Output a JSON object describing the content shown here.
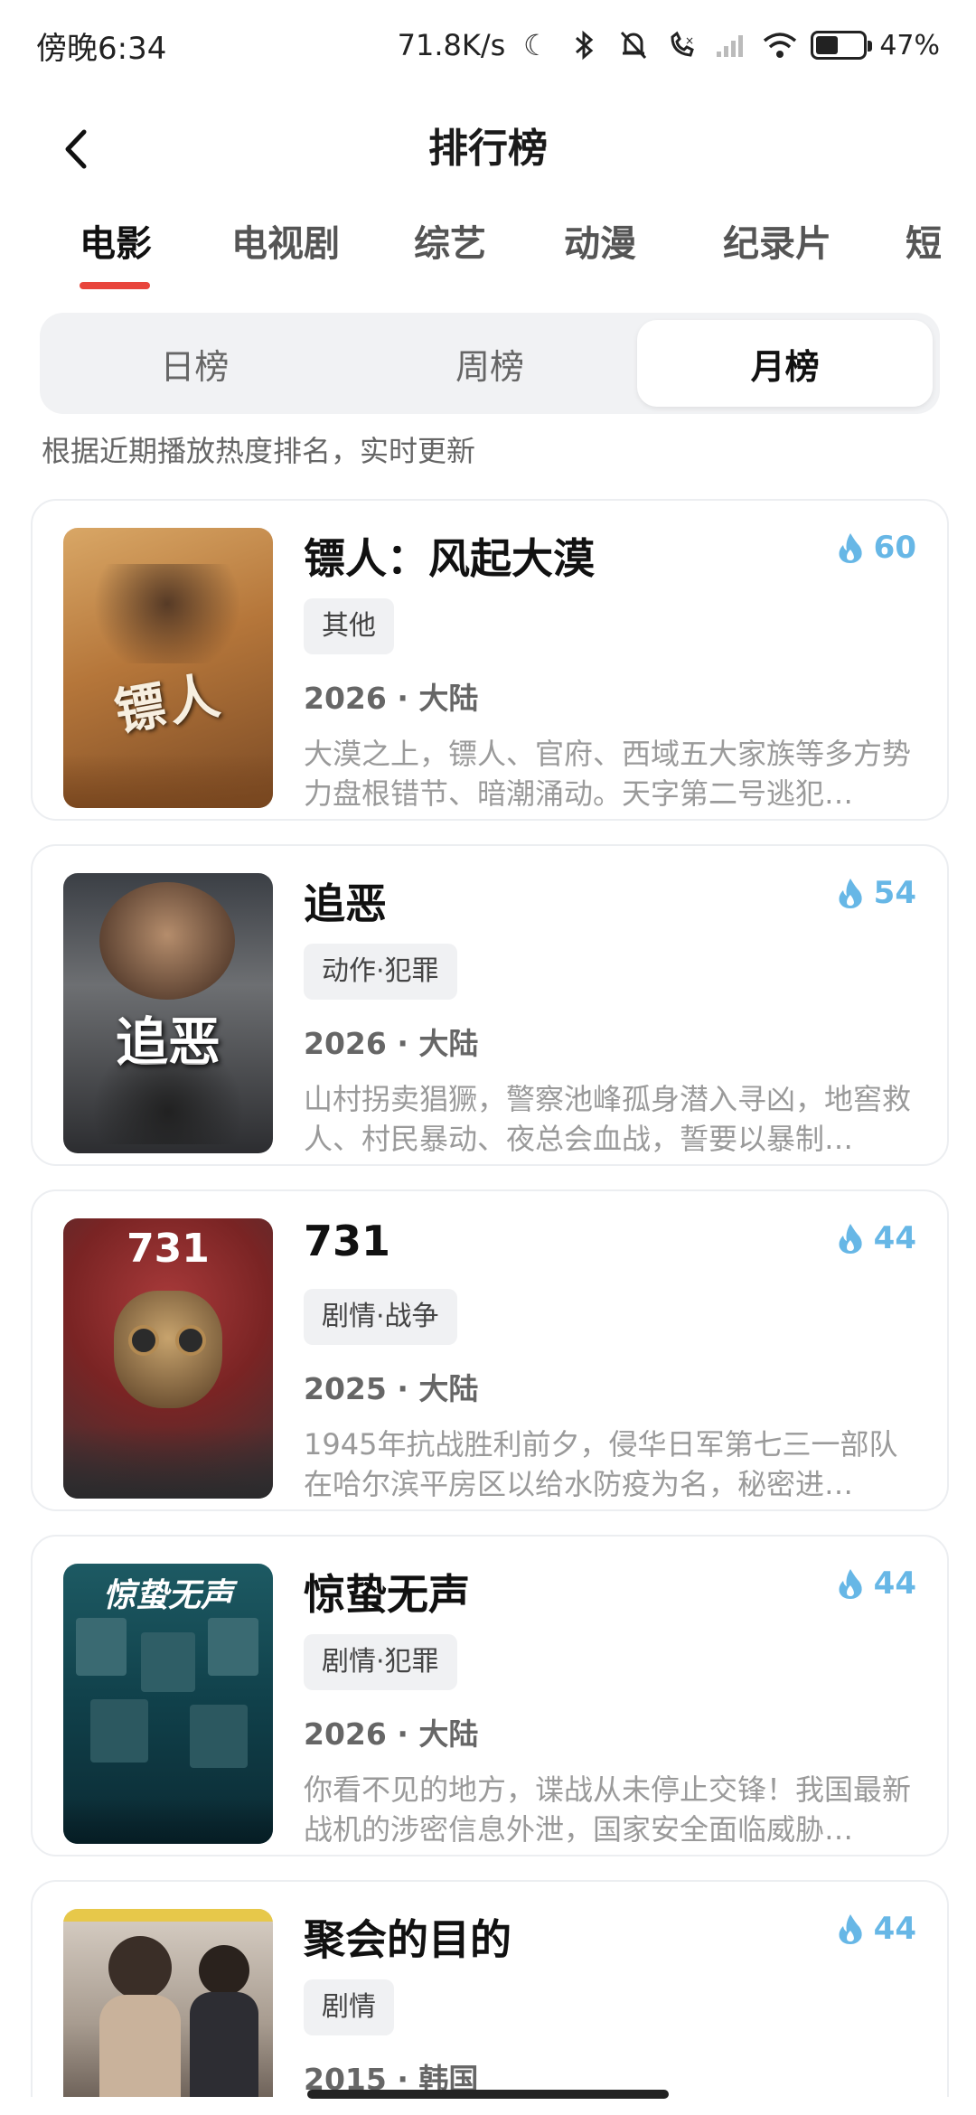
{
  "status_bar": {
    "time": "傍晚6:34",
    "network_speed": "71.8K/s",
    "battery_percent": "47%",
    "battery_level": 0.47,
    "icons": [
      "moon-icon",
      "bluetooth-icon",
      "bell-muted-icon",
      "call-icon",
      "signal-icon",
      "wifi-icon",
      "battery-icon"
    ]
  },
  "header": {
    "title": "排行榜"
  },
  "category_tabs": [
    {
      "label": "电影",
      "active": true
    },
    {
      "label": "电视剧",
      "active": false
    },
    {
      "label": "综艺",
      "active": false
    },
    {
      "label": "动漫",
      "active": false
    },
    {
      "label": "纪录片",
      "active": false
    },
    {
      "label": "短",
      "active": false
    }
  ],
  "period_tabs": [
    {
      "label": "日榜",
      "active": false
    },
    {
      "label": "周榜",
      "active": false
    },
    {
      "label": "月榜",
      "active": true
    }
  ],
  "subtitle": "根据近期播放热度排名，实时更新",
  "accent_color": "#e8453c",
  "heat_color": "#67b7e6",
  "items": [
    {
      "title": "镖人：风起大漠",
      "heat": "60",
      "tag": "其他",
      "meta": "2026 · 大陆",
      "desc": "大漠之上，镖人、官府、西域五大家族等多方势力盘根错节、暗潮涌动。天字第二号逃犯…",
      "poster_text": "镖人"
    },
    {
      "title": "追恶",
      "heat": "54",
      "tag": "动作·犯罪",
      "meta": "2026 · 大陆",
      "desc": "山村拐卖猖獗，警察池峰孤身潜入寻凶，地窖救人、村民暴动、夜总会血战，誓要以暴制…",
      "poster_text": "追恶"
    },
    {
      "title": "731",
      "heat": "44",
      "tag": "剧情·战争",
      "meta": "2025 · 大陆",
      "desc": "1945年抗战胜利前夕，侵华日军第七三一部队在哈尔滨平房区以给水防疫为名，秘密进…",
      "poster_text": "731"
    },
    {
      "title": "惊蛰无声",
      "heat": "44",
      "tag": "剧情·犯罪",
      "meta": "2026 · 大陆",
      "desc": "你看不见的地方，谍战从未停止交锋！我国最新战机的涉密信息外泄，国家安全面临威胁…",
      "poster_text": "惊蛰无声"
    },
    {
      "title": "聚会的目的",
      "heat": "44",
      "tag": "剧情",
      "meta": "2015 · 韩国",
      "desc": "",
      "poster_text": ""
    }
  ]
}
